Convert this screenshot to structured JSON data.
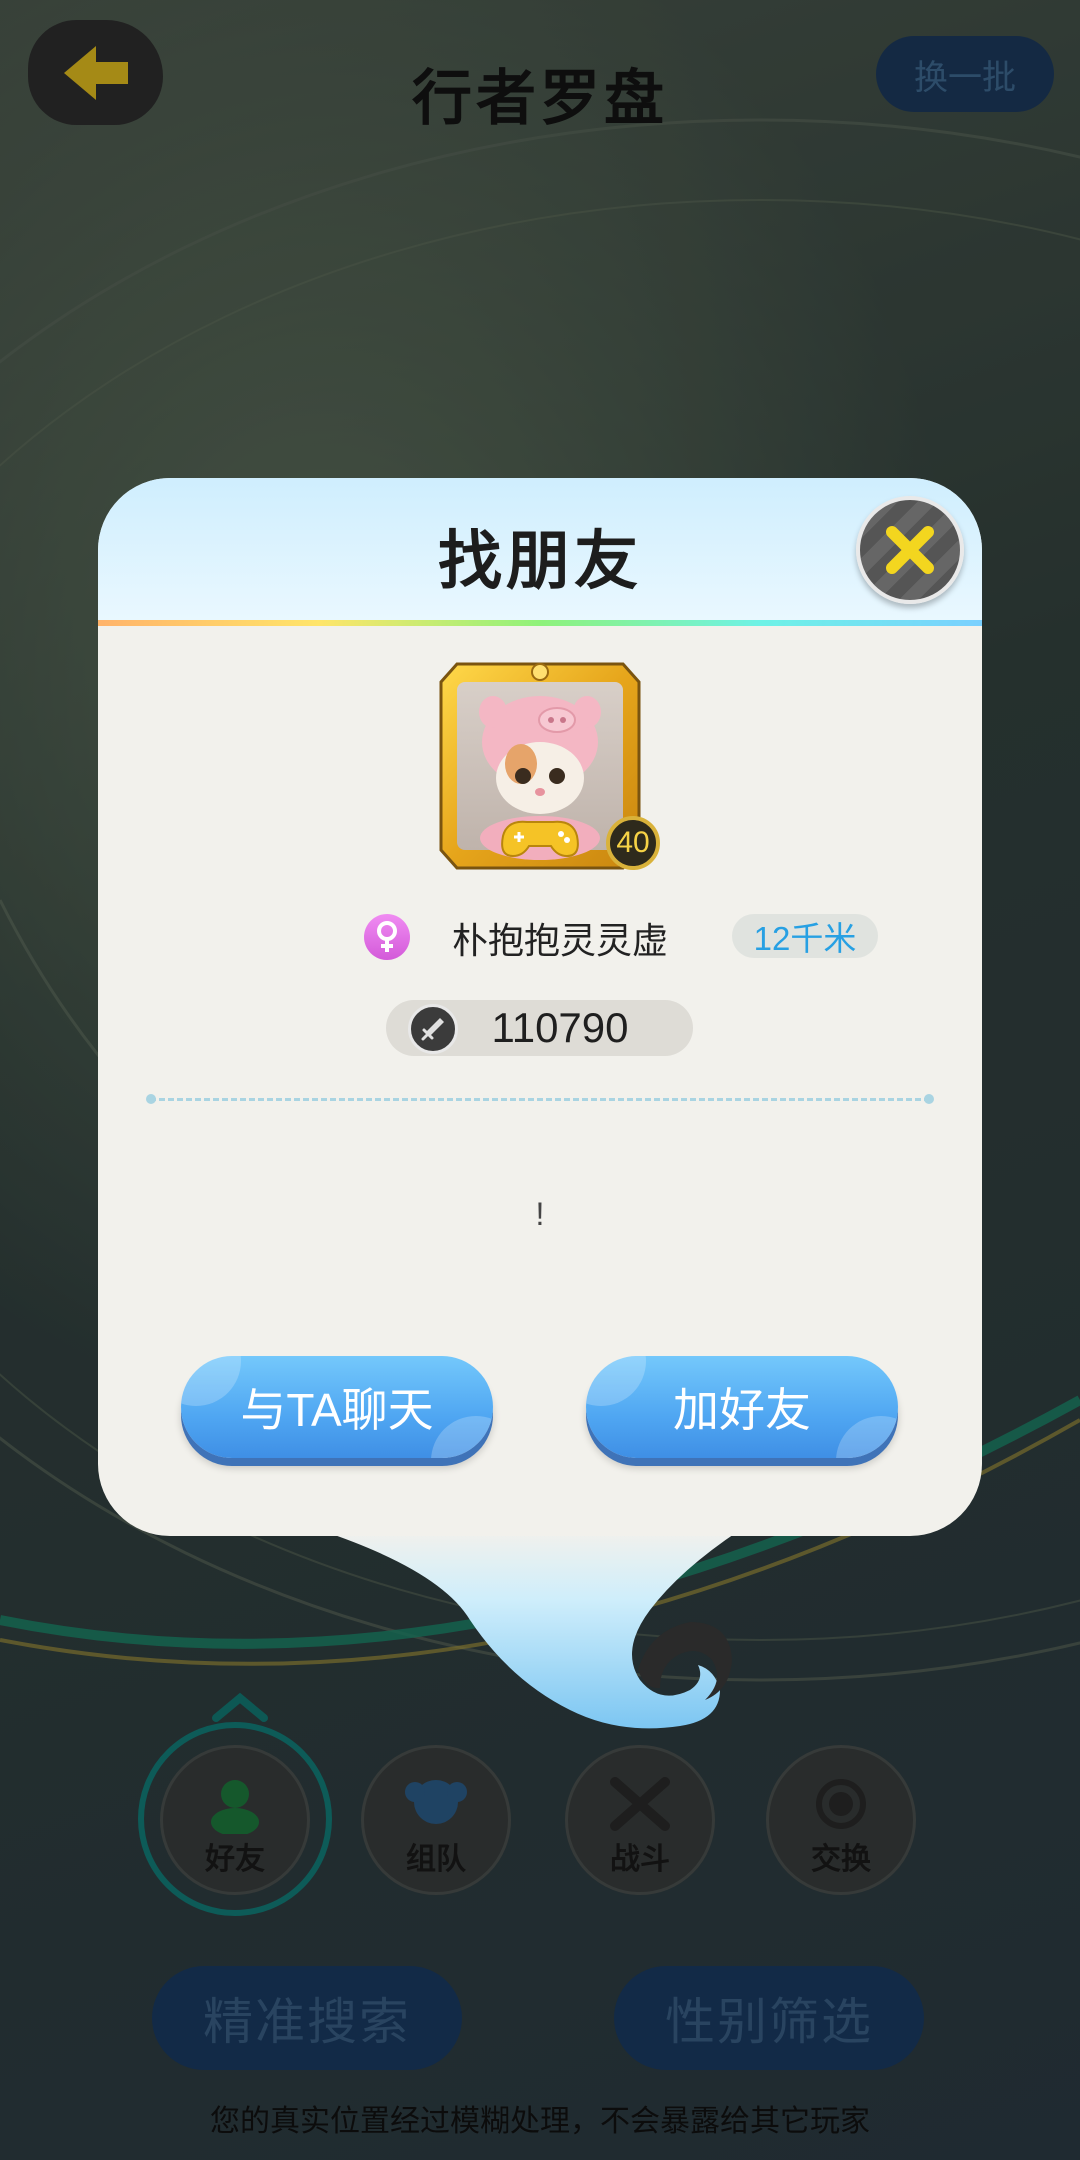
{
  "header": {
    "title": "行者罗盘",
    "refresh_label": "换一批"
  },
  "categories": [
    {
      "label": "好友",
      "selected": true
    },
    {
      "label": "组队",
      "selected": false
    },
    {
      "label": "战斗",
      "selected": false
    },
    {
      "label": "交换",
      "selected": false
    }
  ],
  "bottom_buttons": {
    "search_label": "精准搜索",
    "gender_filter_label": "性别筛选"
  },
  "privacy_note": "您的真实位置经过模糊处理，不会暴露给其它玩家",
  "modal": {
    "title": "找朋友",
    "user": {
      "name": "朴抱抱灵灵虚",
      "gender": "female",
      "distance": "12千米",
      "level": "40",
      "power": "110790",
      "signature": "!"
    },
    "chat_button": "与TA聊天",
    "add_friend_button": "加好友"
  },
  "colors": {
    "accent_blue": "#4fa6f2",
    "distance_text": "#27a0e3",
    "gender_female": "#d35ad9",
    "frame_gold": "#e6b325"
  },
  "icons": [
    "back-arrow-icon",
    "close-icon",
    "female-icon",
    "sword-icon",
    "gamepad-icon",
    "friend-icon",
    "team-icon",
    "battle-icon",
    "exchange-icon",
    "chevron-up-icon"
  ]
}
